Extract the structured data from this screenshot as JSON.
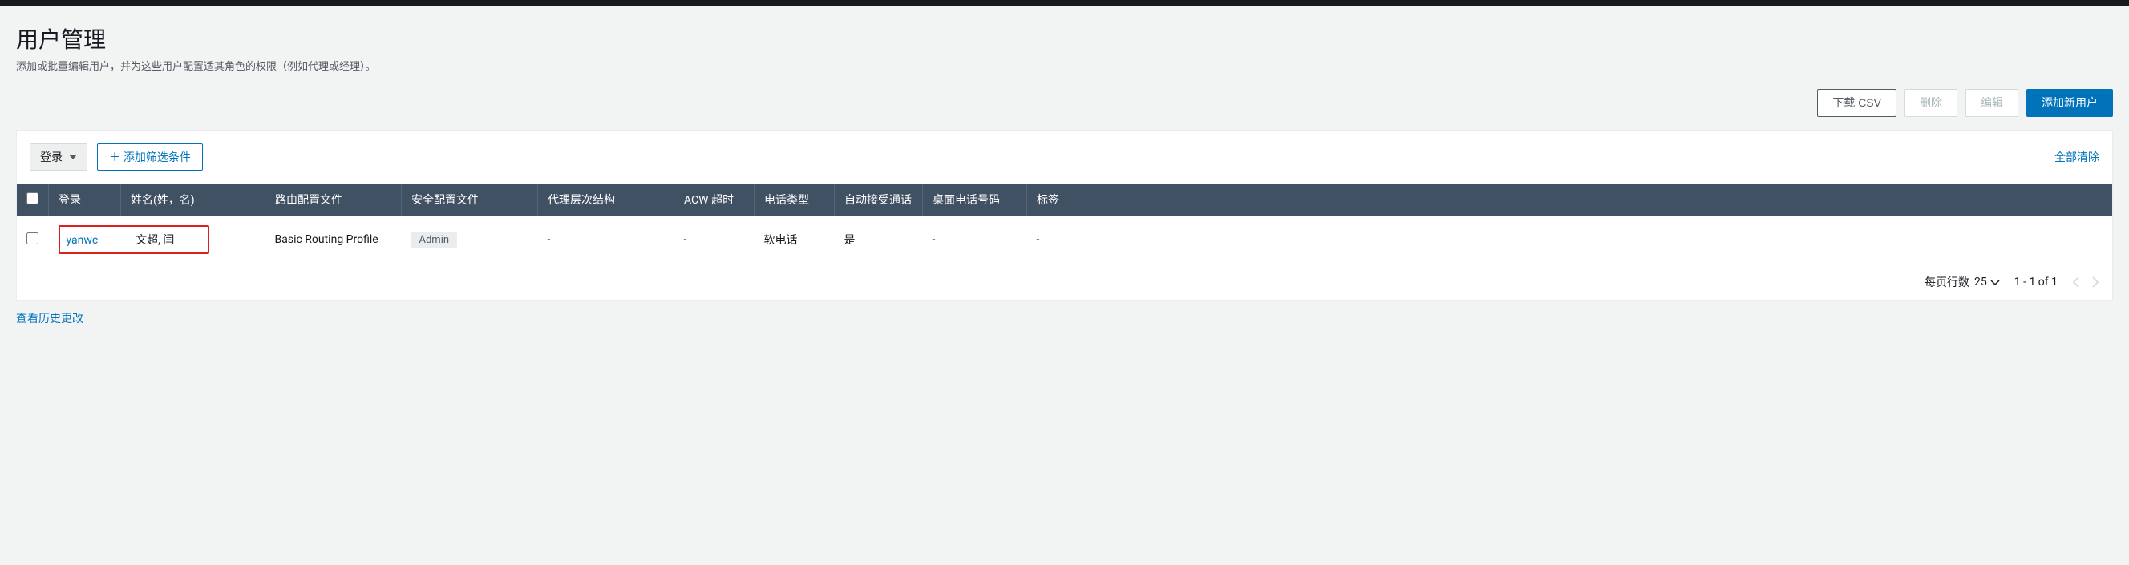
{
  "header": {
    "title": "用户管理",
    "description": "添加或批量编辑用户，并为这些用户配置适其角色的权限（例如代理或经理）。"
  },
  "actions": {
    "download_csv": "下载 CSV",
    "delete": "删除",
    "edit": "编辑",
    "add_user": "添加新用户"
  },
  "toolbar": {
    "login_filter_label": "登录",
    "add_filter": "＋ 添加筛选条件",
    "clear_all": "全部清除"
  },
  "table": {
    "headers": {
      "login": "登录",
      "name": "姓名(姓，名)",
      "routing": "路由配置文件",
      "security": "安全配置文件",
      "hierarchy": "代理层次结构",
      "acw": "ACW 超时",
      "phone_type": "电话类型",
      "auto_accept": "自动接受通话",
      "desk_phone": "桌面电话号码",
      "tags": "标签"
    },
    "rows": [
      {
        "login": "yanwc",
        "name": "文超, 闫",
        "routing": "Basic Routing Profile",
        "security": "Admin",
        "hierarchy": "-",
        "acw": "-",
        "phone_type": "软电话",
        "auto_accept": "是",
        "desk_phone": "-",
        "tags": "-"
      }
    ]
  },
  "pagination": {
    "per_page_label": "每页行数",
    "per_page_value": "25",
    "range": "1 - 1 of 1"
  },
  "footer": {
    "history_link": "查看历史更改"
  }
}
